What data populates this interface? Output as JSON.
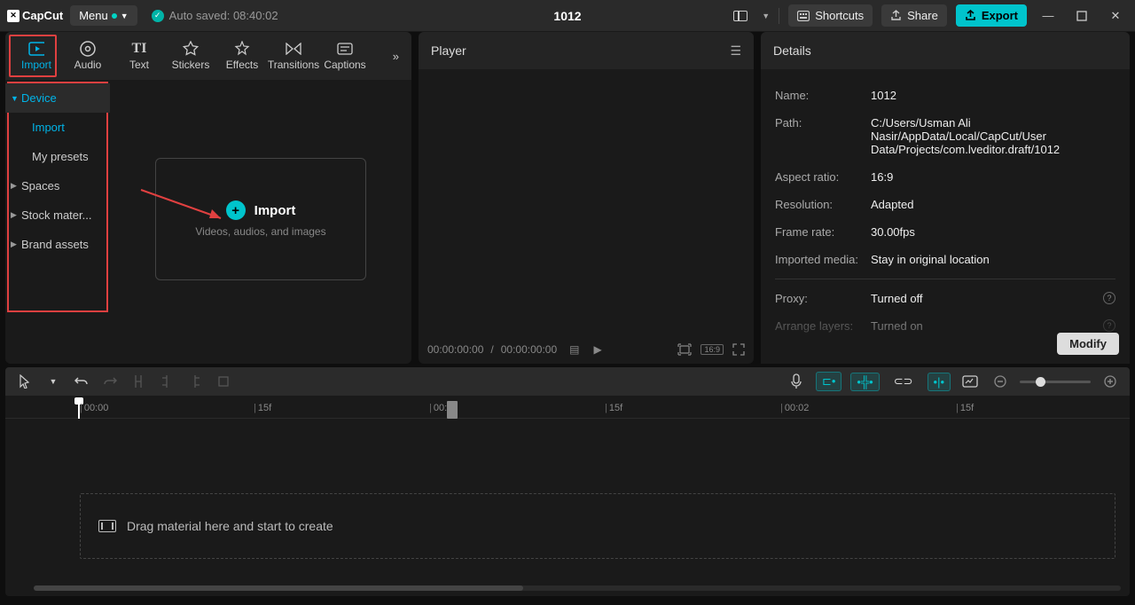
{
  "app": {
    "name": "CapCut"
  },
  "menu": {
    "label": "Menu"
  },
  "autosave": "Auto saved: 08:40:02",
  "project_title": "1012",
  "titlebar": {
    "shortcuts": "Shortcuts",
    "share": "Share",
    "export": "Export"
  },
  "top_tabs": [
    {
      "id": "import",
      "label": "Import"
    },
    {
      "id": "audio",
      "label": "Audio"
    },
    {
      "id": "text",
      "label": "Text"
    },
    {
      "id": "stickers",
      "label": "Stickers"
    },
    {
      "id": "effects",
      "label": "Effects"
    },
    {
      "id": "transitions",
      "label": "Transitions"
    },
    {
      "id": "captions",
      "label": "Captions"
    }
  ],
  "sidebar": {
    "device": "Device",
    "import": "Import",
    "my_presets": "My presets",
    "spaces": "Spaces",
    "stock_materials": "Stock mater...",
    "brand_assets": "Brand assets"
  },
  "import_box": {
    "title": "Import",
    "hint": "Videos, audios, and images"
  },
  "player": {
    "title": "Player",
    "time_current": "00:00:00:00",
    "time_total": "00:00:00:00",
    "ratio_badge": "16:9"
  },
  "details": {
    "title": "Details",
    "name_l": "Name:",
    "name_v": "1012",
    "path_l": "Path:",
    "path_v": "C:/Users/Usman Ali Nasir/AppData/Local/CapCut/User Data/Projects/com.lveditor.draft/1012",
    "aspect_l": "Aspect ratio:",
    "aspect_v": "16:9",
    "resolution_l": "Resolution:",
    "resolution_v": "Adapted",
    "framerate_l": "Frame rate:",
    "framerate_v": "30.00fps",
    "imported_l": "Imported media:",
    "imported_v": "Stay in original location",
    "proxy_l": "Proxy:",
    "proxy_v": "Turned off",
    "arrange_l": "Arrange layers:",
    "arrange_v": "Turned on",
    "modify": "Modify"
  },
  "ruler": {
    "t0": "00:00",
    "t15a": "15f",
    "t1": "00:01",
    "t15b": "15f",
    "t2": "00:02",
    "t15c": "15f"
  },
  "timeline": {
    "drop_hint": "Drag material here and start to create"
  }
}
